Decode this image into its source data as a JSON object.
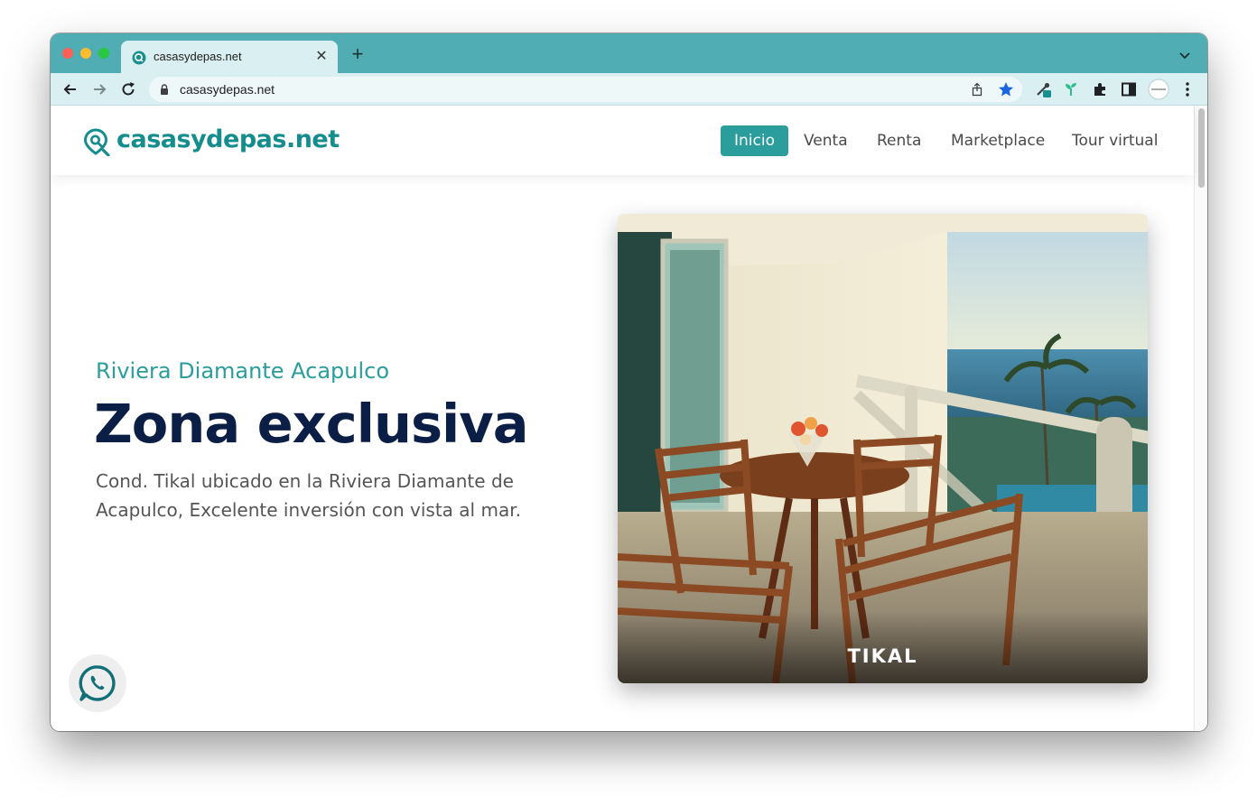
{
  "browser": {
    "tab_title": "casasydepas.net",
    "url": "casasydepas.net",
    "colors": {
      "tabbar": "#4fadb3",
      "toolbar": "#d9eff1"
    }
  },
  "site": {
    "brand": "casasydepas.net",
    "nav": [
      {
        "label": "Inicio",
        "active": true
      },
      {
        "label": "Venta",
        "active": false
      },
      {
        "label": "Renta",
        "active": false
      },
      {
        "label": "Marketplace",
        "active": false
      },
      {
        "label": "Tour virtual",
        "active": false
      }
    ],
    "colors": {
      "accent": "#2a9d9c",
      "headline": "#0b1e45"
    }
  },
  "hero": {
    "subtitle": "Riviera Diamante Acapulco",
    "headline": "Zona exclusiva",
    "description": "Cond. Tikal ubicado en la Riviera Diamante de Acapulco, Excelente inversión con vista al mar.",
    "image_caption": "TIKAL"
  },
  "floating": {
    "icon": "whatsapp-icon"
  }
}
